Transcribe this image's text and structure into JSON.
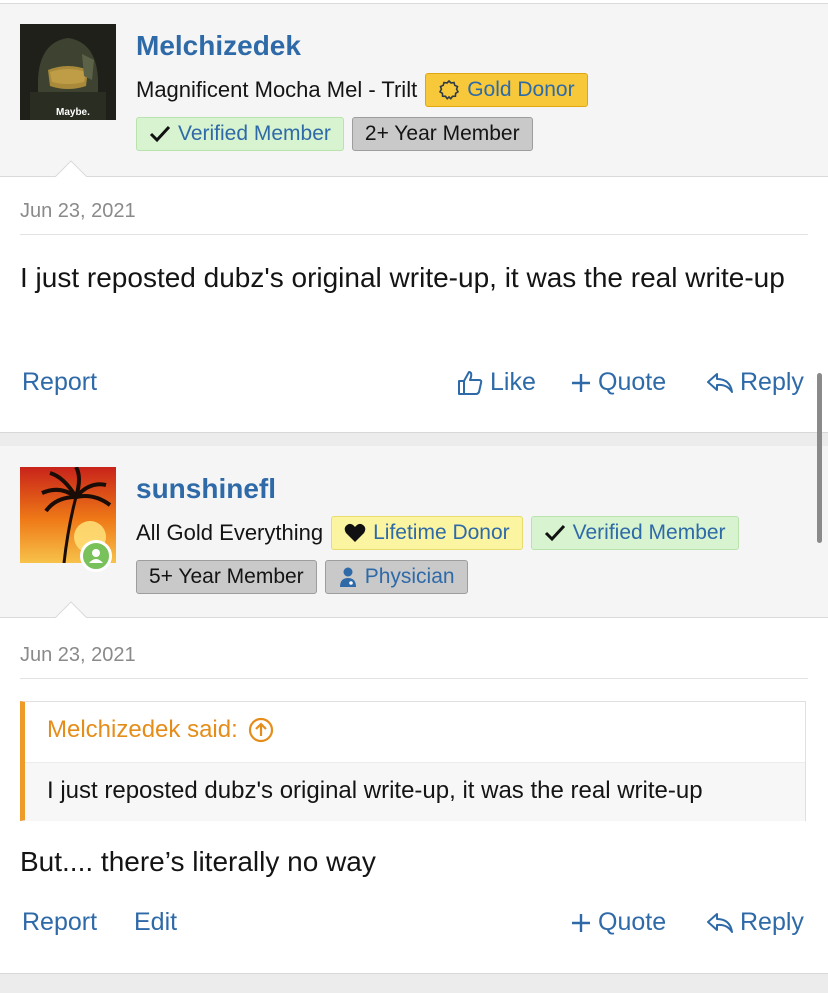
{
  "colors": {
    "link": "#2f6aa8",
    "quote_accent": "#ef9b2a",
    "gold": "#f6c83a",
    "verified": "#d7f3cf",
    "lifetime": "#fbf4a1"
  },
  "posts": [
    {
      "username": "Melchizedek",
      "avatar_caption": "Maybe.",
      "user_title": "Magnificent Mocha Mel - Trilt",
      "badges_line1": [
        {
          "label": "Gold Donor",
          "icon": "gold-coin-icon"
        }
      ],
      "badges_line2": [
        {
          "label": "Verified Member",
          "icon": "check-icon"
        },
        {
          "label": "2+ Year Member",
          "icon": ""
        }
      ],
      "date": "Jun 23, 2021",
      "body": "I just reposted dubz's original write-up, it was the real write-up",
      "actions": {
        "report": "Report",
        "like": "Like",
        "quote": "Quote",
        "reply": "Reply"
      }
    },
    {
      "username": "sunshinefl",
      "user_title": "All Gold Everything",
      "badges_line1": [
        {
          "label": "Lifetime Donor",
          "icon": "heart-icon"
        },
        {
          "label": "Verified Member",
          "icon": "check-icon"
        }
      ],
      "badges_line2": [
        {
          "label": "5+ Year Member",
          "icon": ""
        },
        {
          "label": "Physician",
          "icon": "doctor-icon"
        }
      ],
      "date": "Jun 23, 2021",
      "quote": {
        "author_label": "Melchizedek said:",
        "text": "I just reposted dubz's original write-up, it was the real write-up"
      },
      "body": "But.... there’s literally no way",
      "actions": {
        "report": "Report",
        "edit": "Edit",
        "quote": "Quote",
        "reply": "Reply"
      }
    }
  ]
}
